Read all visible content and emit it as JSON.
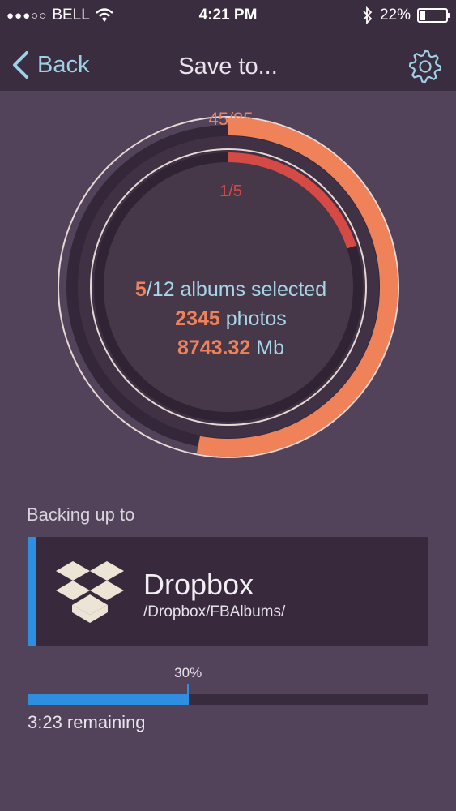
{
  "status_bar": {
    "signal": "●●●○○",
    "carrier": "BELL",
    "time": "4:21 PM",
    "battery_percent": "22%",
    "battery_level": 0.22,
    "icons": [
      "wifi-icon",
      "bluetooth-icon",
      "battery-icon"
    ]
  },
  "nav": {
    "back_label": "Back",
    "title": "Save to...",
    "settings_icon": "gear-icon"
  },
  "progress_ring": {
    "outer_count": "45/85",
    "outer_fraction": 0.53,
    "inner_count": "1/5",
    "inner_fraction": 0.2,
    "albums_selected": "5",
    "albums_total_text": "/12 albums selected",
    "photos_count": "2345",
    "photos_label": " photos",
    "size_value": "8743.32",
    "size_unit": " Mb"
  },
  "backup": {
    "label": "Backing up to",
    "service_name": "Dropbox",
    "service_path": "/Dropbox/FBAlbums/",
    "service_icon": "dropbox-icon",
    "progress_label": "30%",
    "progress_fraction": 0.4,
    "remaining": "3:23 remaining"
  },
  "colors": {
    "background": "#53435a",
    "bar": "#3a2d3f",
    "accent_orange": "#f0825a",
    "accent_red": "#d64a45",
    "accent_blue": "#2e8fe0",
    "text_blue": "#a7d5e9"
  }
}
